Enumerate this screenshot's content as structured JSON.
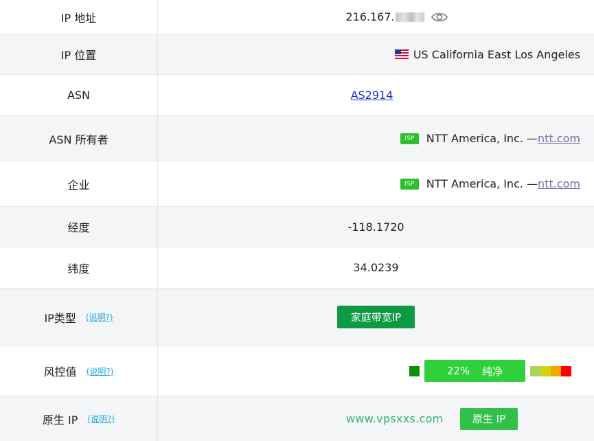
{
  "rows": {
    "ip_address": {
      "label": "IP 地址",
      "value": "216.167."
    },
    "ip_location": {
      "label": "IP 位置",
      "value": "US California East Los Angeles"
    },
    "asn": {
      "label": "ASN",
      "value": "AS2914"
    },
    "asn_owner": {
      "label": "ASN 所有者",
      "badge": "ISP",
      "company": "NTT America, Inc. —",
      "domain": "ntt.com"
    },
    "enterprise": {
      "label": "企业",
      "badge": "ISP",
      "company": "NTT America, Inc. —",
      "domain": "ntt.com"
    },
    "longitude": {
      "label": "经度",
      "value": "-118.1720"
    },
    "latitude": {
      "label": "纬度",
      "value": "34.0239"
    },
    "ip_type": {
      "label": "IP类型",
      "help": "(说明?)",
      "button": "家庭带宽IP"
    },
    "risk": {
      "label": "风控值",
      "help": "(说明?)",
      "score": "22%",
      "status": "纯净",
      "score_fraction": 0.22
    },
    "native_ip": {
      "label": "原生 IP",
      "help": "(说明?)",
      "watermark": "www.vpsxxs.com",
      "button": "原生 IP"
    }
  },
  "colors": {
    "isp_badge": "#2bc02b",
    "ip_type_button": "#0e9a43",
    "risk_bar": "#2fd13a",
    "native_button": "#31c148",
    "link": "#1a2fd6",
    "help_link": "#1ea7e6",
    "risk_scale": [
      "#a4d65e",
      "#d4d40c",
      "#f0a800",
      "#ff0000"
    ]
  },
  "icons": {
    "eye": "eye-icon",
    "flag": "us-flag-icon"
  }
}
